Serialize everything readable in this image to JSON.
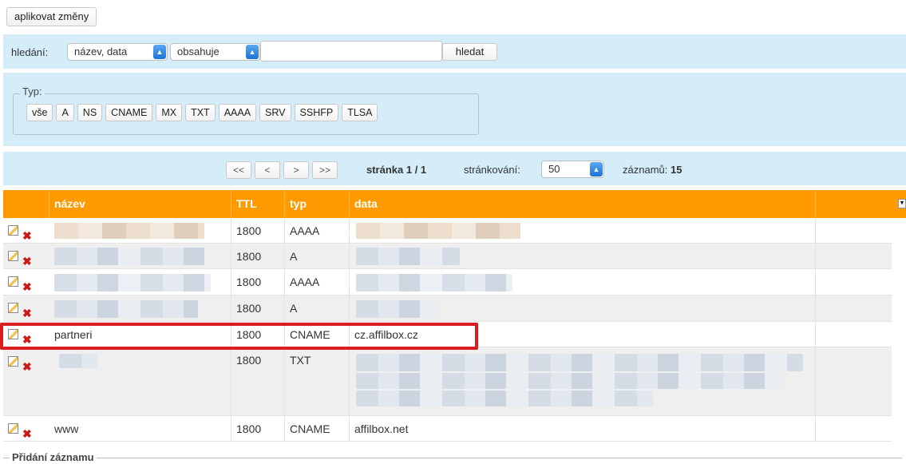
{
  "toolbar": {
    "apply_label": "aplikovat změny"
  },
  "search": {
    "label": "hledání:",
    "field_selected": "název, data",
    "operator_selected": "obsahuje",
    "query_value": "",
    "button_label": "hledat"
  },
  "type_filter": {
    "legend": "Typ:",
    "buttons": [
      "vše",
      "A",
      "NS",
      "CNAME",
      "MX",
      "TXT",
      "AAAA",
      "SRV",
      "SSHFP",
      "TLSA"
    ]
  },
  "pager": {
    "first": "<<",
    "prev": "<",
    "next": ">",
    "last": ">>",
    "page_info": "stránka 1 / 1",
    "per_page_label": "stránkování:",
    "per_page_value": "50",
    "count_label": "záznamů:",
    "count_value": "15"
  },
  "table": {
    "headers": {
      "name": "název",
      "ttl": "TTL",
      "type": "typ",
      "data": "data"
    },
    "rows": [
      {
        "name": "",
        "ttl": "1800",
        "type": "AAAA",
        "data": "",
        "blurred": true
      },
      {
        "name": "",
        "ttl": "1800",
        "type": "A",
        "data": "",
        "blurred": true
      },
      {
        "name": "",
        "ttl": "1800",
        "type": "AAAA",
        "data": "",
        "blurred": true
      },
      {
        "name": "",
        "ttl": "1800",
        "type": "A",
        "data": "",
        "blurred": true
      },
      {
        "name": "partneri",
        "ttl": "1800",
        "type": "CNAME",
        "data": "cz.affilbox.cz",
        "highlighted": true
      },
      {
        "name": "",
        "ttl": "1800",
        "type": "TXT",
        "data": "",
        "blurred": true
      },
      {
        "name": "www",
        "ttl": "1800",
        "type": "CNAME",
        "data": "affilbox.net"
      }
    ]
  },
  "add_record": {
    "legend": "Přidání záznamu"
  },
  "colors": {
    "header_orange": "#ff9a00",
    "panel_blue": "#d5edf8",
    "highlight_red": "#d81e1e",
    "delete_red": "#cc1a1a"
  },
  "icons": {
    "edit": "edit-icon",
    "delete": "delete-icon",
    "select_arrow": "select-arrow-icon",
    "menu": "column-menu-icon"
  }
}
